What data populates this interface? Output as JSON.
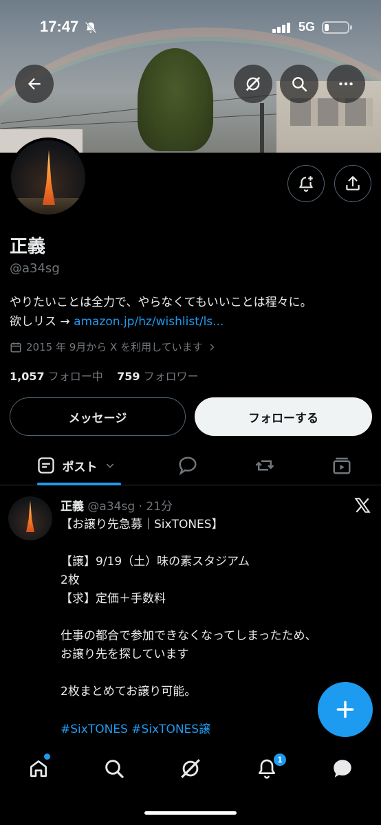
{
  "status_bar": {
    "time": "17:47",
    "network": "5G"
  },
  "header": {
    "back_icon": "arrow-left-icon",
    "grok_icon": "grok-icon",
    "search_icon": "search-icon",
    "more_icon": "more-icon"
  },
  "profile": {
    "name": "正義",
    "handle": "@a34sg",
    "bio_text": "やりたいことは全力で、やらなくてもいいことは程々に。",
    "bio_prefix": "欲しリス → ",
    "bio_link": "amazon.jp/hz/wishlist/ls...",
    "joined": "2015 年 9月から X を利用しています",
    "following_count": "1,057",
    "following_label": "フォロー中",
    "followers_count": "759",
    "followers_label": "フォロワー"
  },
  "actions": {
    "message_label": "メッセージ",
    "follow_label": "フォローする"
  },
  "tabs": {
    "posts_label": "ポスト"
  },
  "post": {
    "name": "正義",
    "meta": "@a34sg · 21分",
    "body": "【お譲り先急募｜SixTONES】\n\n【譲】9/19（土）味の素スタジアム\n2枚\n【求】定価＋手数料\n\n仕事の都合で参加できなくなってしまったため、\nお譲り先を探しています\n\n2枚まとめてお譲り可能。",
    "hashtags": "#SixTONES #SixTONES譲"
  },
  "bottom_nav": {
    "notification_badge": "1"
  },
  "colors": {
    "accent": "#1d9bf0",
    "background": "#000000",
    "text": "#e7e9ea",
    "muted": "#71767b"
  }
}
